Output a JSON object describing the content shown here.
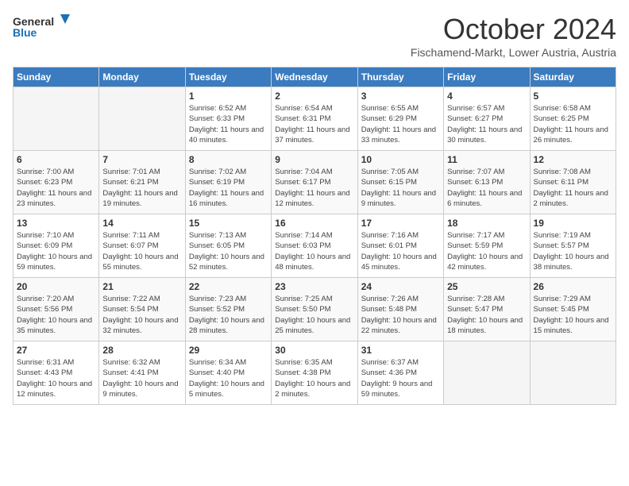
{
  "logo": {
    "line1": "General",
    "line2": "Blue"
  },
  "title": "October 2024",
  "subtitle": "Fischamend-Markt, Lower Austria, Austria",
  "days_of_week": [
    "Sunday",
    "Monday",
    "Tuesday",
    "Wednesday",
    "Thursday",
    "Friday",
    "Saturday"
  ],
  "weeks": [
    [
      {
        "day": "",
        "info": ""
      },
      {
        "day": "",
        "info": ""
      },
      {
        "day": "1",
        "info": "Sunrise: 6:52 AM\nSunset: 6:33 PM\nDaylight: 11 hours and 40 minutes."
      },
      {
        "day": "2",
        "info": "Sunrise: 6:54 AM\nSunset: 6:31 PM\nDaylight: 11 hours and 37 minutes."
      },
      {
        "day": "3",
        "info": "Sunrise: 6:55 AM\nSunset: 6:29 PM\nDaylight: 11 hours and 33 minutes."
      },
      {
        "day": "4",
        "info": "Sunrise: 6:57 AM\nSunset: 6:27 PM\nDaylight: 11 hours and 30 minutes."
      },
      {
        "day": "5",
        "info": "Sunrise: 6:58 AM\nSunset: 6:25 PM\nDaylight: 11 hours and 26 minutes."
      }
    ],
    [
      {
        "day": "6",
        "info": "Sunrise: 7:00 AM\nSunset: 6:23 PM\nDaylight: 11 hours and 23 minutes."
      },
      {
        "day": "7",
        "info": "Sunrise: 7:01 AM\nSunset: 6:21 PM\nDaylight: 11 hours and 19 minutes."
      },
      {
        "day": "8",
        "info": "Sunrise: 7:02 AM\nSunset: 6:19 PM\nDaylight: 11 hours and 16 minutes."
      },
      {
        "day": "9",
        "info": "Sunrise: 7:04 AM\nSunset: 6:17 PM\nDaylight: 11 hours and 12 minutes."
      },
      {
        "day": "10",
        "info": "Sunrise: 7:05 AM\nSunset: 6:15 PM\nDaylight: 11 hours and 9 minutes."
      },
      {
        "day": "11",
        "info": "Sunrise: 7:07 AM\nSunset: 6:13 PM\nDaylight: 11 hours and 6 minutes."
      },
      {
        "day": "12",
        "info": "Sunrise: 7:08 AM\nSunset: 6:11 PM\nDaylight: 11 hours and 2 minutes."
      }
    ],
    [
      {
        "day": "13",
        "info": "Sunrise: 7:10 AM\nSunset: 6:09 PM\nDaylight: 10 hours and 59 minutes."
      },
      {
        "day": "14",
        "info": "Sunrise: 7:11 AM\nSunset: 6:07 PM\nDaylight: 10 hours and 55 minutes."
      },
      {
        "day": "15",
        "info": "Sunrise: 7:13 AM\nSunset: 6:05 PM\nDaylight: 10 hours and 52 minutes."
      },
      {
        "day": "16",
        "info": "Sunrise: 7:14 AM\nSunset: 6:03 PM\nDaylight: 10 hours and 48 minutes."
      },
      {
        "day": "17",
        "info": "Sunrise: 7:16 AM\nSunset: 6:01 PM\nDaylight: 10 hours and 45 minutes."
      },
      {
        "day": "18",
        "info": "Sunrise: 7:17 AM\nSunset: 5:59 PM\nDaylight: 10 hours and 42 minutes."
      },
      {
        "day": "19",
        "info": "Sunrise: 7:19 AM\nSunset: 5:57 PM\nDaylight: 10 hours and 38 minutes."
      }
    ],
    [
      {
        "day": "20",
        "info": "Sunrise: 7:20 AM\nSunset: 5:56 PM\nDaylight: 10 hours and 35 minutes."
      },
      {
        "day": "21",
        "info": "Sunrise: 7:22 AM\nSunset: 5:54 PM\nDaylight: 10 hours and 32 minutes."
      },
      {
        "day": "22",
        "info": "Sunrise: 7:23 AM\nSunset: 5:52 PM\nDaylight: 10 hours and 28 minutes."
      },
      {
        "day": "23",
        "info": "Sunrise: 7:25 AM\nSunset: 5:50 PM\nDaylight: 10 hours and 25 minutes."
      },
      {
        "day": "24",
        "info": "Sunrise: 7:26 AM\nSunset: 5:48 PM\nDaylight: 10 hours and 22 minutes."
      },
      {
        "day": "25",
        "info": "Sunrise: 7:28 AM\nSunset: 5:47 PM\nDaylight: 10 hours and 18 minutes."
      },
      {
        "day": "26",
        "info": "Sunrise: 7:29 AM\nSunset: 5:45 PM\nDaylight: 10 hours and 15 minutes."
      }
    ],
    [
      {
        "day": "27",
        "info": "Sunrise: 6:31 AM\nSunset: 4:43 PM\nDaylight: 10 hours and 12 minutes."
      },
      {
        "day": "28",
        "info": "Sunrise: 6:32 AM\nSunset: 4:41 PM\nDaylight: 10 hours and 9 minutes."
      },
      {
        "day": "29",
        "info": "Sunrise: 6:34 AM\nSunset: 4:40 PM\nDaylight: 10 hours and 5 minutes."
      },
      {
        "day": "30",
        "info": "Sunrise: 6:35 AM\nSunset: 4:38 PM\nDaylight: 10 hours and 2 minutes."
      },
      {
        "day": "31",
        "info": "Sunrise: 6:37 AM\nSunset: 4:36 PM\nDaylight: 9 hours and 59 minutes."
      },
      {
        "day": "",
        "info": ""
      },
      {
        "day": "",
        "info": ""
      }
    ]
  ]
}
